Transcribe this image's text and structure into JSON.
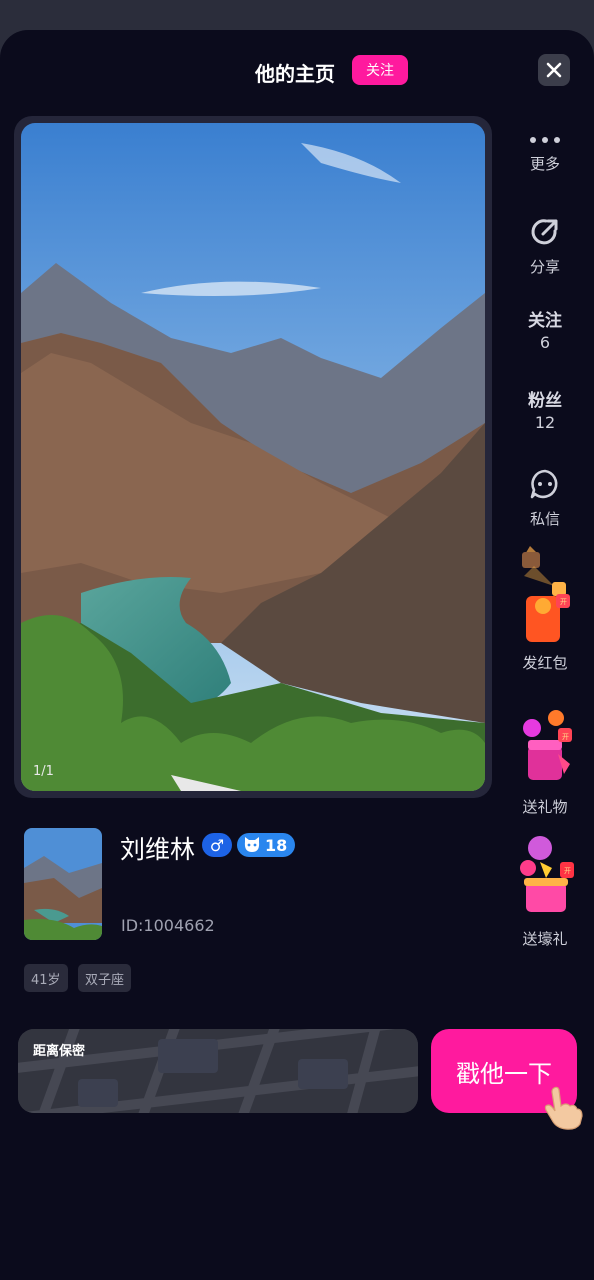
{
  "header": {
    "title": "他的主页",
    "follow_label": "关注"
  },
  "photo": {
    "counter": "1/1"
  },
  "sidebar": {
    "more": "更多",
    "share": "分享",
    "follow_label": "关注",
    "follow_count": "6",
    "fans_label": "粉丝",
    "fans_count": "12",
    "message": "私信",
    "red_packet": "发红包",
    "send_gift": "送礼物",
    "send_gift_box": "送壕礼"
  },
  "profile": {
    "name": "刘维林",
    "gender_symbol": "♂",
    "level": "18",
    "user_id": "ID:1004662",
    "tags": [
      "41岁",
      "双子座"
    ]
  },
  "actions": {
    "distance_label": "距离保密",
    "poke_label": "戳他一下"
  },
  "colors": {
    "accent": "#ff1a9e",
    "background": "#0b0b1c",
    "badge_blue": "#1d63e6"
  }
}
